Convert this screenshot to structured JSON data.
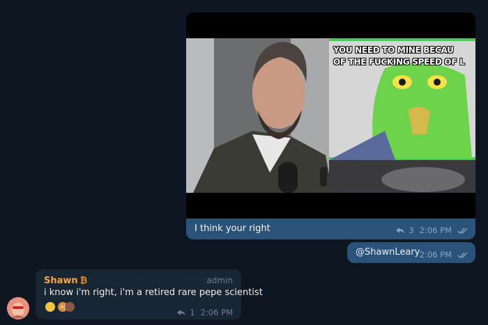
{
  "outgoing_media": {
    "meme_caption_line1": "YOU NEED TO MINE BECAU",
    "meme_caption_line2": "OF THE FUCKING SPEED OF L",
    "caption": "I think your right",
    "replies": "3",
    "time": "2:06 PM"
  },
  "outgoing_mention": {
    "text": "@ShawnLeary",
    "time": "2:06 PM"
  },
  "incoming": {
    "sender": "Shawn",
    "sender_badge": "₿",
    "role": "admin",
    "text": "i know i'm right, i'm a retired rare pepe scientist",
    "replies": "1",
    "time": "2:06 PM",
    "reaction_initials": "AJ"
  },
  "colors": {
    "background": "#0e1621",
    "outgoing_bubble": "#2b5278",
    "incoming_bubble": "#182533",
    "sender_name": "#f7a743",
    "meta_out": "#7da8d3"
  }
}
